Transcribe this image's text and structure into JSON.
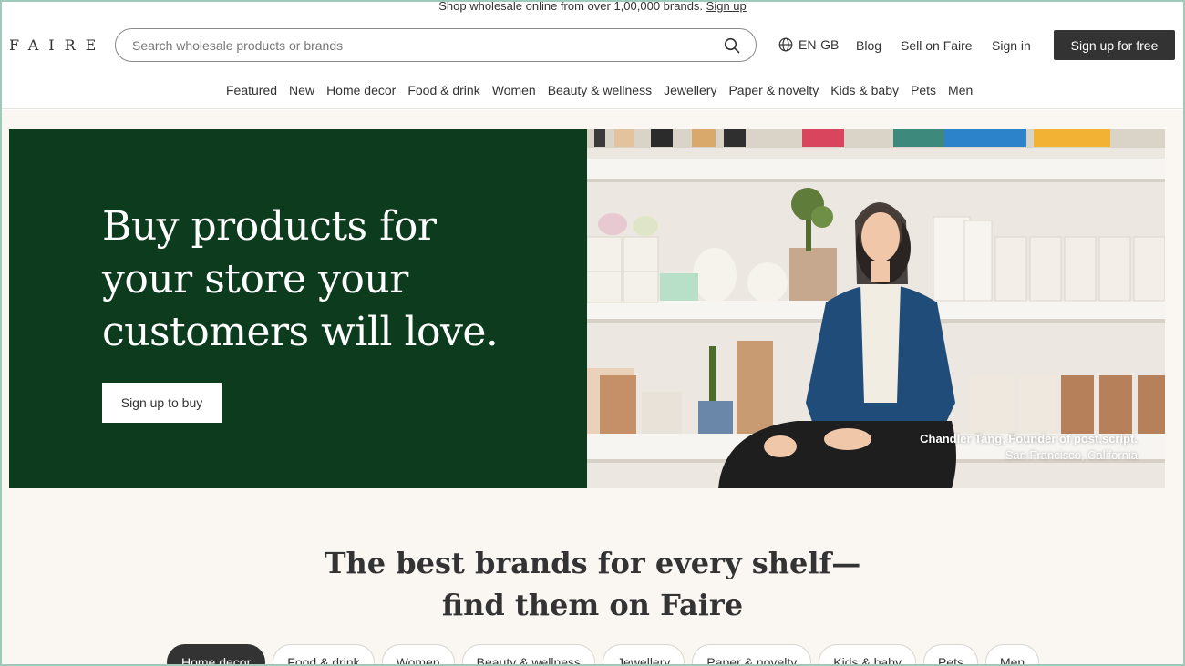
{
  "announcement": {
    "text": "Shop wholesale online from over 1,00,000 brands.",
    "link": "Sign up"
  },
  "header": {
    "logo": "FAIRE",
    "search_placeholder": "Search wholesale products or brands",
    "language": "EN-GB",
    "blog": "Blog",
    "sell": "Sell on Faire",
    "sign_in": "Sign in",
    "sign_up": "Sign up for free"
  },
  "nav": {
    "items": [
      "Featured",
      "New",
      "Home decor",
      "Food & drink",
      "Women",
      "Beauty & wellness",
      "Jewellery",
      "Paper & novelty",
      "Kids & baby",
      "Pets",
      "Men"
    ]
  },
  "hero": {
    "title": "Buy products for your store your customers will love.",
    "button": "Sign up to buy",
    "caption_name": "Chandler Tang, Founder of post.script.",
    "caption_location": "San Francisco, California"
  },
  "brands_section": {
    "title_line1": "The best brands for every shelf—",
    "title_line2": "find them on Faire",
    "pills": [
      "Home decor",
      "Food & drink",
      "Women",
      "Beauty & wellness",
      "Jewellery",
      "Paper & novelty",
      "Kids & baby",
      "Pets",
      "Men"
    ],
    "active_pill": "Home decor"
  },
  "colors": {
    "hero_green": "#0d3b1d",
    "primary_dark": "#333333",
    "background": "#faf7f3"
  }
}
